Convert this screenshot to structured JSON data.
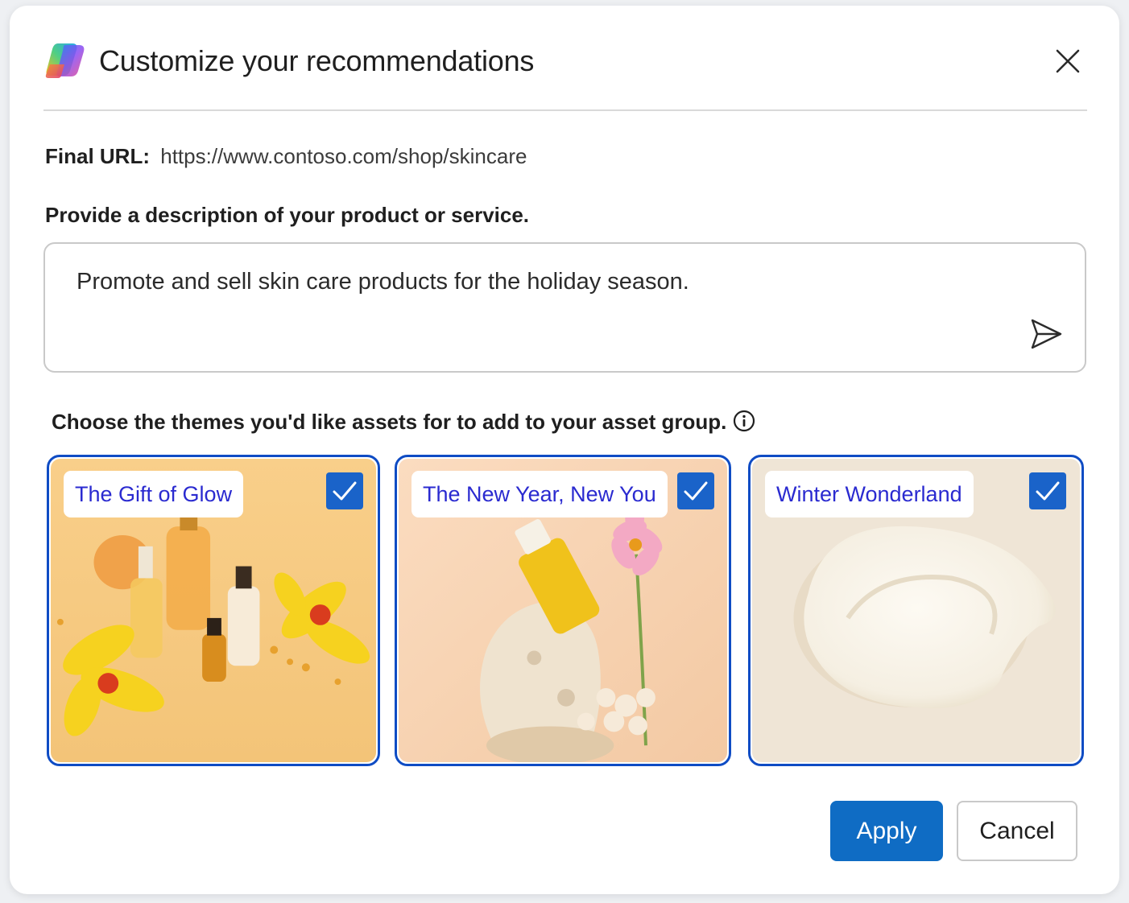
{
  "dialog": {
    "title": "Customize your recommendations",
    "final_url_label": "Final URL:",
    "final_url_value": "https://www.contoso.com/shop/skincare",
    "description_label": "Provide a description of your product or service.",
    "description_value": "Promote and sell skin care products for the holiday season.",
    "themes_label": "Choose the themes you'd like assets for to add to your asset group."
  },
  "themes": [
    {
      "label": "The Gift of Glow",
      "checked": true,
      "image": "skincare-serum-bottles-with-yellow-orchids"
    },
    {
      "label": "The New Year, New You",
      "checked": true,
      "image": "oil-bottle-on-coral-rock-with-pink-flower"
    },
    {
      "label": "Winter Wonderland",
      "checked": true,
      "image": "cream-swatch-on-beige"
    }
  ],
  "buttons": {
    "apply": "Apply",
    "cancel": "Cancel"
  },
  "icons": {
    "logo": "copilot-logo-icon",
    "close": "close-icon",
    "send": "send-icon",
    "info": "info-icon",
    "check": "checkmark-icon"
  },
  "colors": {
    "accent": "#0f6cc4",
    "card_border": "#0f4cc4",
    "checkbox": "#1a63c9",
    "theme_label_text": "#2a2ad0"
  }
}
